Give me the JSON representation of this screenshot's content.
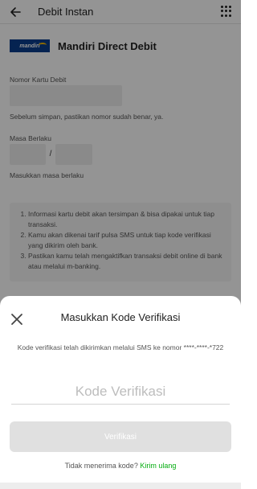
{
  "appbar": {
    "title": "Debit Instan",
    "back_icon": "arrow-left-icon",
    "menu_icon": "grid-menu-icon"
  },
  "bank": {
    "logo_text": "mandiri",
    "name": "Mandiri Direct Debit",
    "brand_color": "#0a3d8c"
  },
  "form": {
    "card_label": "Nomor Kartu Debit",
    "card_hint": "Sebelum simpan, pastikan nomor sudah benar, ya.",
    "expiry_label": "Masa Berlaku",
    "expiry_separator": "/",
    "expiry_hint": "Masukkan masa berlaku"
  },
  "info": {
    "items": [
      "Informasi kartu debit akan tersimpan & bisa dipakai untuk tiap transaksi.",
      "Kamu akan dikenai tarif pulsa SMS untuk tiap kode verifikasi yang dikirim oleh bank.",
      "Pastikan kamu telah mengaktifkan transaksi debit online di bank atau melalui m-banking."
    ]
  },
  "sheet": {
    "title": "Masukkan Kode Verifikasi",
    "description": "Kode verifikasi telah dikirimkan melalui SMS ke nomor ****-****-*722",
    "code_placeholder": "Kode Verifikasi",
    "code_value": "",
    "verify_label": "Verifikasi",
    "resend_prefix": "Tidak menerima kode?",
    "resend_link": "Kirim ulang",
    "close_icon": "close-icon"
  },
  "colors": {
    "accent_green": "#03ac0e",
    "button_disabled": "#e0e0e0"
  }
}
